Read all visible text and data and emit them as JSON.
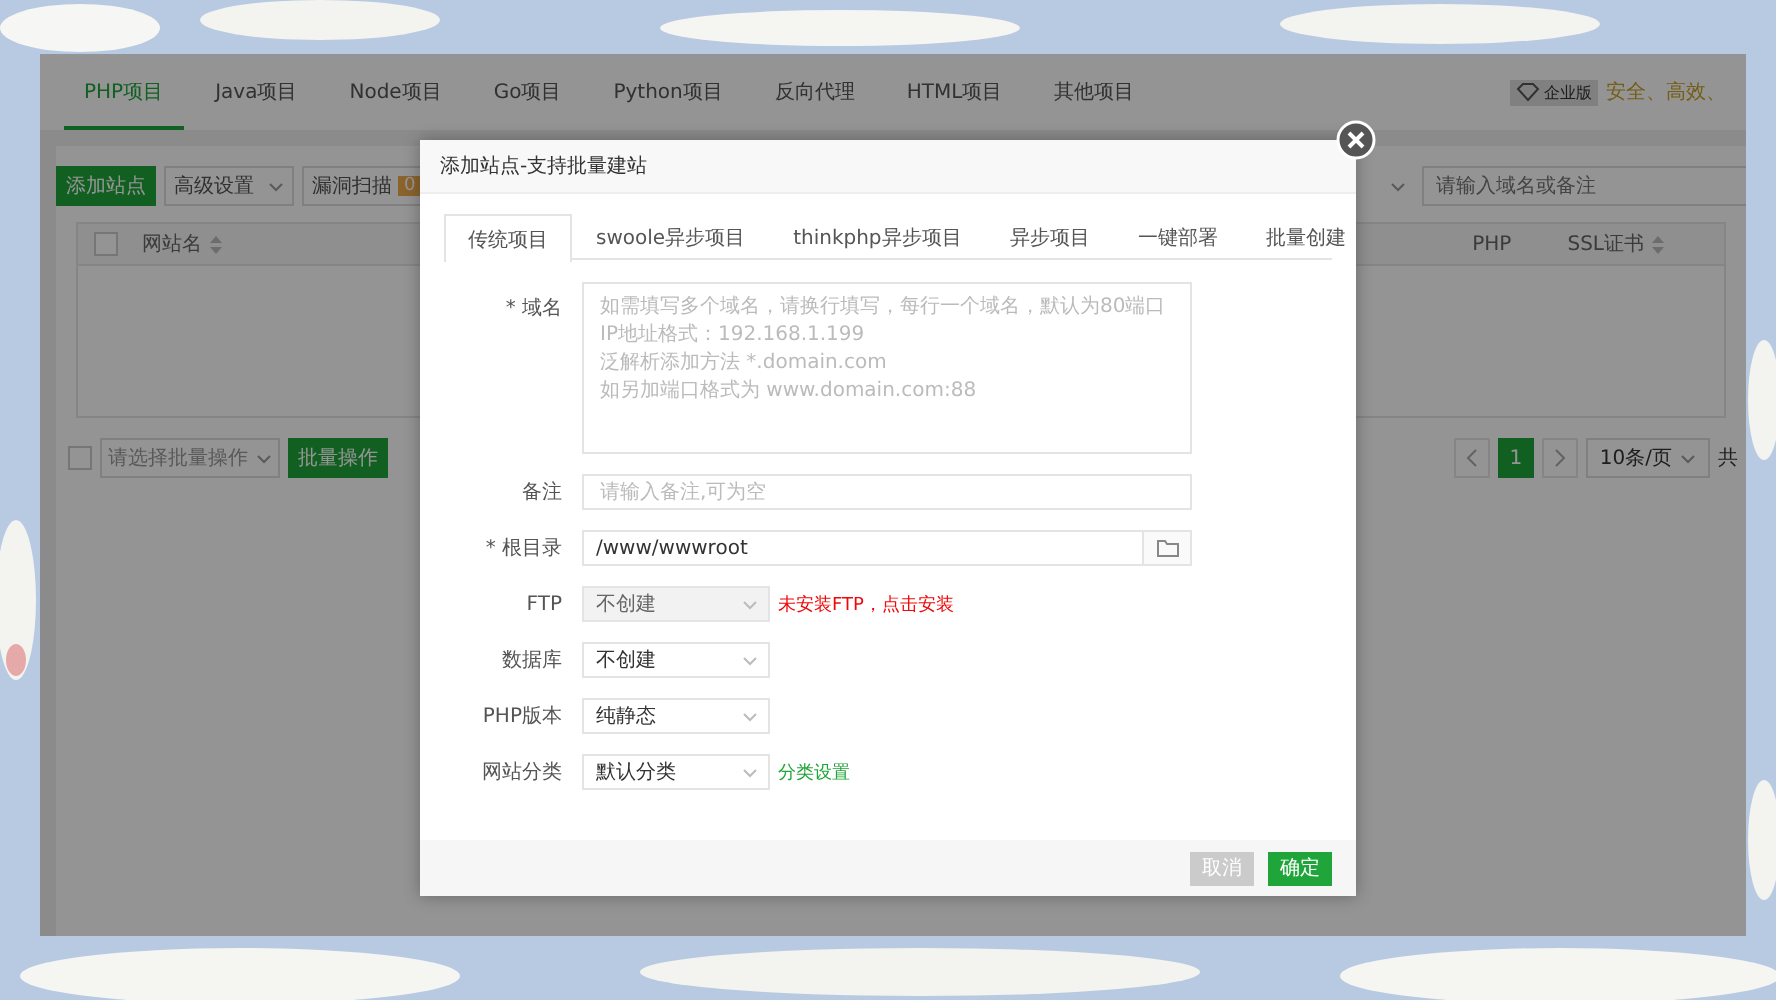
{
  "top_tabs": [
    {
      "label": "PHP项目",
      "selected": true
    },
    {
      "label": "Java项目",
      "selected": false
    },
    {
      "label": "Node项目",
      "selected": false
    },
    {
      "label": "Go项目",
      "selected": false
    },
    {
      "label": "Python项目",
      "selected": false
    },
    {
      "label": "反向代理",
      "selected": false
    },
    {
      "label": "HTML项目",
      "selected": false
    },
    {
      "label": "其他项目",
      "selected": false
    }
  ],
  "edition": {
    "badge": "企业版",
    "slogan": "安全、高效、"
  },
  "toolbar": {
    "add_button": "添加站点",
    "settings_dropdown": "高级设置",
    "scan_button": "漏洞扫描",
    "scan_count": "0",
    "search": {
      "placeholder": "请输入域名或备注"
    }
  },
  "table": {
    "select_all": {
      "checked": false
    },
    "columns": [
      {
        "label": "网站名",
        "sortable": true
      },
      {
        "label": "PHP",
        "sortable": false
      },
      {
        "label": "SSL证书",
        "sortable": true
      }
    ]
  },
  "table_footer": {
    "row_checkbox": {
      "checked": false
    },
    "batch_select": {
      "placeholder": "请选择批量操作"
    },
    "batch_button": "批量操作",
    "pages": [
      {
        "label": "1",
        "selected": true
      }
    ],
    "page_size": "10条/页",
    "total": "共"
  },
  "dialog": {
    "title": "添加站点-支持批量建站",
    "tabs": [
      {
        "label": "传统项目",
        "selected": true
      },
      {
        "label": "swoole异步项目",
        "selected": false
      },
      {
        "label": "thinkphp异步项目",
        "selected": false
      },
      {
        "label": "异步项目",
        "selected": false
      },
      {
        "label": "一键部署",
        "selected": false
      },
      {
        "label": "批量创建",
        "selected": false
      }
    ],
    "fields": [
      {
        "kind": "textarea",
        "label": "* 域名",
        "placeholder": "如需填写多个域名，请换行填写，每行一个域名，默认为80端口\nIP地址格式：192.168.1.199\n泛解析添加方法 *.domain.com\n如另加端口格式为 www.domain.com:88"
      },
      {
        "kind": "input",
        "label": "备注",
        "placeholder": "请输入备注,可为空"
      },
      {
        "kind": "path",
        "label": "* 根目录",
        "value": "/www/wwwroot"
      },
      {
        "kind": "select",
        "label": "FTP",
        "value": "不创建",
        "disabled": true,
        "note": {
          "text": "未安装FTP，点击安装",
          "kind": "error"
        }
      },
      {
        "kind": "select",
        "label": "数据库",
        "value": "不创建",
        "disabled": false
      },
      {
        "kind": "select",
        "label": "PHP版本",
        "value": "纯静态",
        "disabled": false
      },
      {
        "kind": "select",
        "label": "网站分类",
        "value": "默认分类",
        "disabled": false,
        "note": {
          "text": "分类设置",
          "kind": "link"
        }
      }
    ],
    "buttons": [
      {
        "label": "取消",
        "kind": "secondary"
      },
      {
        "label": "确定",
        "kind": "primary"
      }
    ]
  }
}
